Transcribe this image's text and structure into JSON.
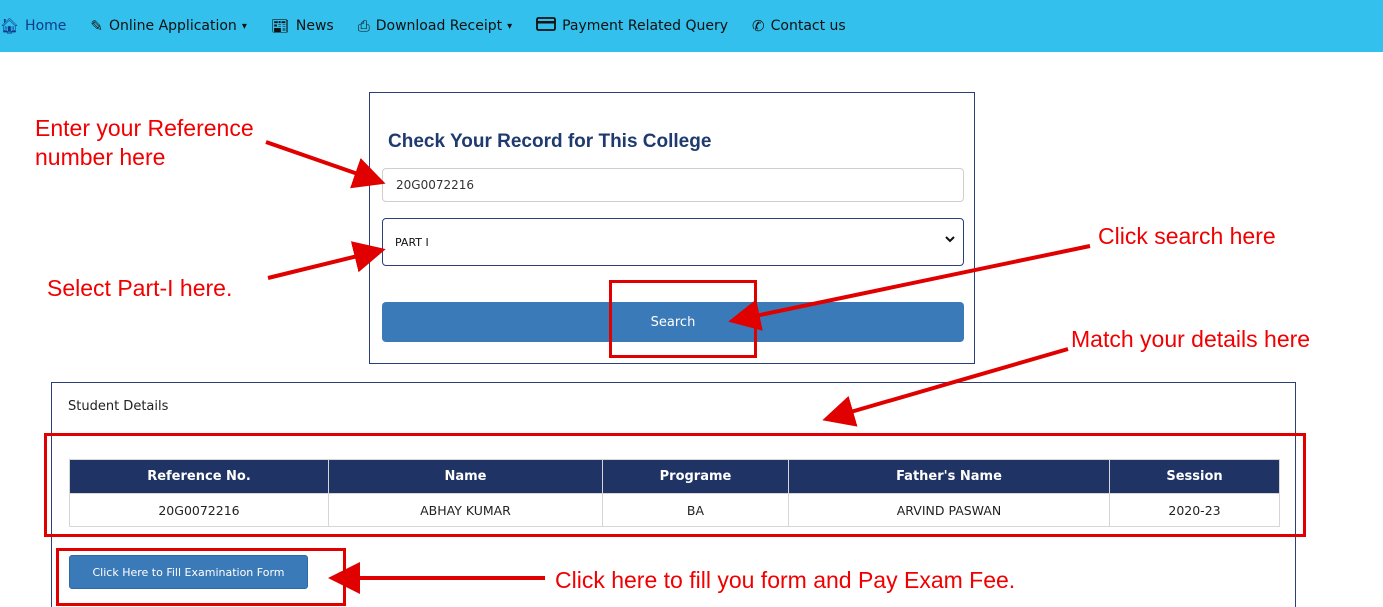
{
  "navbar": {
    "items": [
      {
        "label": "Home",
        "icon": "home-icon"
      },
      {
        "label": "Online Application",
        "icon": "pencil-icon",
        "dropdown": true
      },
      {
        "label": "News",
        "icon": "newspaper-icon"
      },
      {
        "label": "Download Receipt",
        "icon": "printer-icon",
        "dropdown": true
      },
      {
        "label": "Payment Related Query",
        "icon": "credit-card-icon"
      },
      {
        "label": "Contact us",
        "icon": "phone-icon"
      }
    ]
  },
  "record_check": {
    "title": "Check Your Record for This College",
    "reference_value": "20G0072216",
    "part_selected": "PART I",
    "search_label": "Search"
  },
  "student_details": {
    "heading": "Student Details",
    "columns": [
      "Reference No.",
      "Name",
      "Programe",
      "Father's Name",
      "Session"
    ],
    "rows": [
      [
        "20G0072216",
        "ABHAY KUMAR",
        "BA",
        "ARVIND PASWAN",
        "2020-23"
      ]
    ],
    "fill_form_label": "Click Here to Fill Examination Form"
  },
  "annotations": {
    "enter_reference": "Enter your Reference\nnumber here",
    "select_part": "Select Part-I here.",
    "click_search": "Click search here",
    "match_details": "Match your details here",
    "fill_form": "Click here to fill you form and Pay Exam Fee."
  },
  "colors": {
    "navbar": "#33c0ec",
    "primary_button": "#3b7ab8",
    "table_header": "#1f3365",
    "annotation": "#e00000",
    "title": "#1f3a6e"
  }
}
